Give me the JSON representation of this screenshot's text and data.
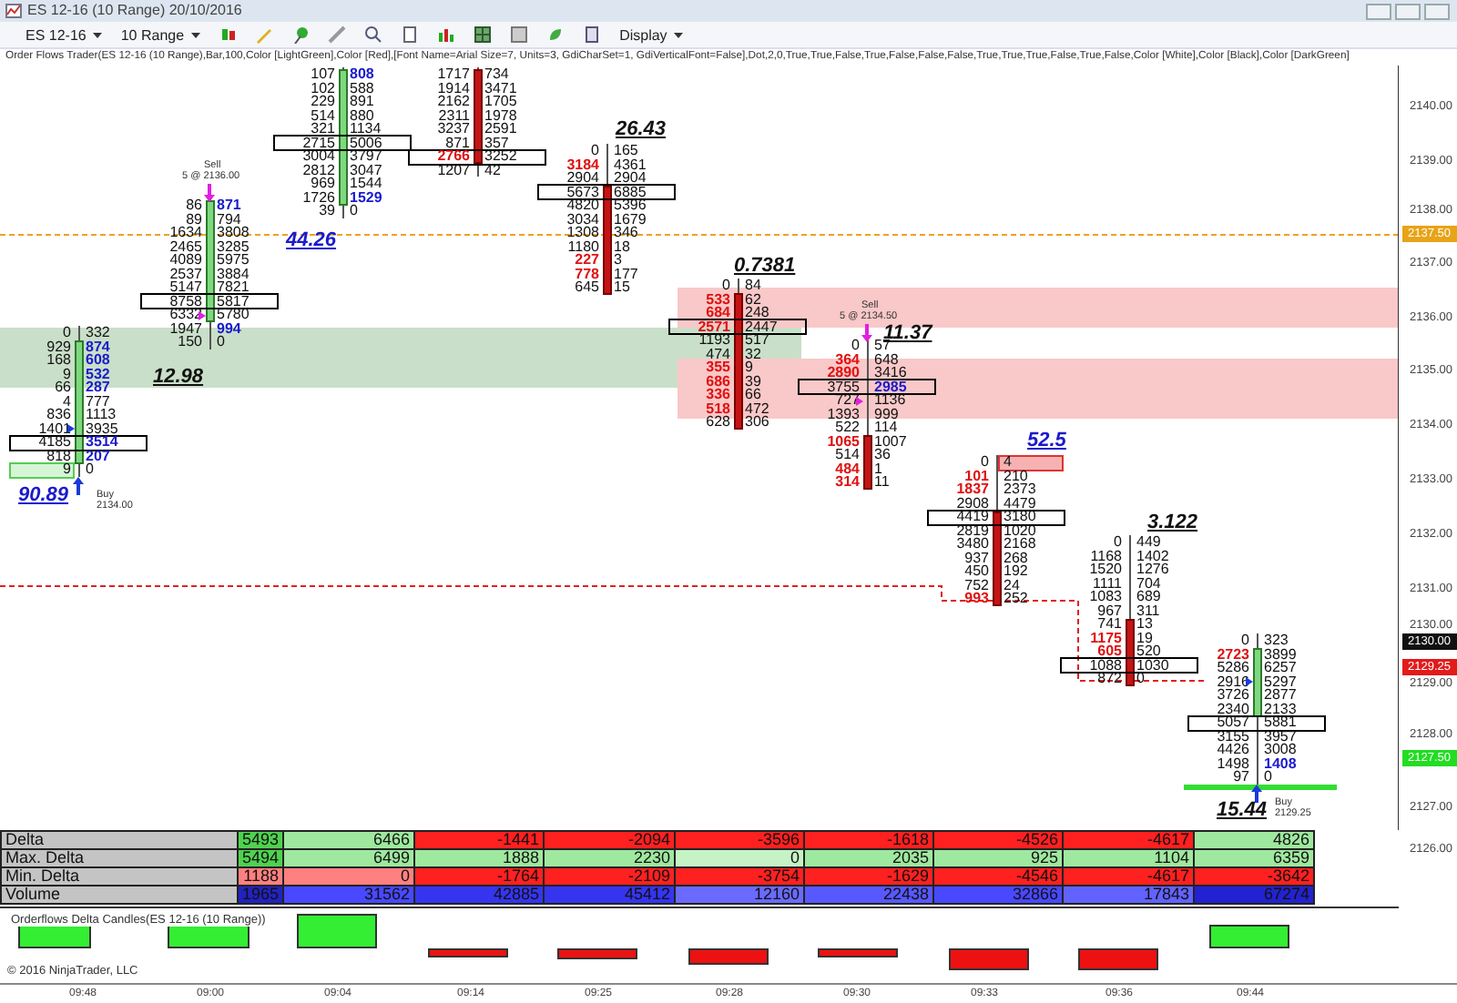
{
  "window": {
    "title": "ES 12-16 (10 Range)  20/10/2016"
  },
  "toolbar": {
    "instrument": "ES 12-16",
    "interval": "10 Range",
    "display": "Display"
  },
  "indicator_label": "Order Flows Trader(ES 12-16 (10 Range),Bar,100,Color [LightGreen],Color [Red],[Font Name=Arial Size=7, Units=3, GdiCharSet=1, GdiVerticalFont=False],Dot,2,0,True,True,False,True,False,False,False,True,True,True,False,True,False,Color [White],Color [Black],Color [DarkGreen]",
  "zones": [
    {
      "kind": "demand"
    },
    {
      "kind": "supply"
    },
    {
      "kind": "supply"
    }
  ],
  "bars": [
    {
      "kind": "up",
      "signal": {
        "kind": "buy",
        "label": "Buy",
        "detail": "2134.00"
      },
      "rows": [
        {
          "bid": {
            "text": "0",
            "kind": "plain"
          },
          "ask": {
            "text": "332",
            "kind": "plain"
          },
          "poc": false
        },
        {
          "bid": {
            "text": "929",
            "kind": "plain"
          },
          "ask": {
            "text": "874",
            "kind": "buy"
          },
          "poc": false
        },
        {
          "bid": {
            "text": "168",
            "kind": "plain"
          },
          "ask": {
            "text": "608",
            "kind": "buy"
          },
          "poc": false
        },
        {
          "bid": {
            "text": "9",
            "kind": "plain"
          },
          "ask": {
            "text": "532",
            "kind": "buy"
          },
          "poc": false
        },
        {
          "bid": {
            "text": "66",
            "kind": "plain"
          },
          "ask": {
            "text": "287",
            "kind": "buy"
          },
          "poc": false
        },
        {
          "bid": {
            "text": "4",
            "kind": "plain"
          },
          "ask": {
            "text": "777",
            "kind": "plain"
          },
          "poc": false
        },
        {
          "bid": {
            "text": "836",
            "kind": "plain"
          },
          "ask": {
            "text": "1113",
            "kind": "plain"
          },
          "poc": false
        },
        {
          "bid": {
            "text": "1401",
            "kind": "plain"
          },
          "ask": {
            "text": "3935",
            "kind": "plain"
          },
          "poc": false
        },
        {
          "bid": {
            "text": "4185",
            "kind": "plain"
          },
          "ask": {
            "text": "3514",
            "kind": "buy"
          },
          "poc": true
        },
        {
          "bid": {
            "text": "818",
            "kind": "plain"
          },
          "ask": {
            "text": "207",
            "kind": "buy"
          },
          "poc": false
        },
        {
          "bid": {
            "text": "9",
            "kind": "green-box"
          },
          "ask": {
            "text": "0",
            "kind": "plain"
          },
          "poc": false
        }
      ]
    },
    {
      "kind": "up",
      "signal": {
        "kind": "sell",
        "label": "Sell",
        "detail": "5 @ 2136.00"
      },
      "rows": [
        {
          "bid": {
            "text": "86",
            "kind": "plain"
          },
          "ask": {
            "text": "871",
            "kind": "buy"
          },
          "poc": false
        },
        {
          "bid": {
            "text": "89",
            "kind": "plain"
          },
          "ask": {
            "text": "794",
            "kind": "plain"
          },
          "poc": false
        },
        {
          "bid": {
            "text": "1634",
            "kind": "plain"
          },
          "ask": {
            "text": "3808",
            "kind": "plain"
          },
          "poc": false
        },
        {
          "bid": {
            "text": "2465",
            "kind": "plain"
          },
          "ask": {
            "text": "3285",
            "kind": "plain"
          },
          "poc": false
        },
        {
          "bid": {
            "text": "4089",
            "kind": "plain"
          },
          "ask": {
            "text": "5975",
            "kind": "plain"
          },
          "poc": false
        },
        {
          "bid": {
            "text": "2537",
            "kind": "plain"
          },
          "ask": {
            "text": "3884",
            "kind": "plain"
          },
          "poc": false
        },
        {
          "bid": {
            "text": "5147",
            "kind": "plain"
          },
          "ask": {
            "text": "7821",
            "kind": "plain"
          },
          "poc": false
        },
        {
          "bid": {
            "text": "8758",
            "kind": "plain"
          },
          "ask": {
            "text": "5817",
            "kind": "plain"
          },
          "poc": true
        },
        {
          "bid": {
            "text": "6332",
            "kind": "plain"
          },
          "ask": {
            "text": "5780",
            "kind": "plain"
          },
          "poc": false
        },
        {
          "bid": {
            "text": "1947",
            "kind": "plain"
          },
          "ask": {
            "text": "994",
            "kind": "buy"
          },
          "poc": false
        },
        {
          "bid": {
            "text": "150",
            "kind": "plain"
          },
          "ask": {
            "text": "0",
            "kind": "plain"
          },
          "poc": false
        }
      ]
    },
    {
      "kind": "up",
      "rows": [
        {
          "bid": {
            "text": "107",
            "kind": "plain"
          },
          "ask": {
            "text": "808",
            "kind": "buy"
          },
          "poc": false
        },
        {
          "bid": {
            "text": "102",
            "kind": "plain"
          },
          "ask": {
            "text": "588",
            "kind": "plain"
          },
          "poc": false
        },
        {
          "bid": {
            "text": "229",
            "kind": "plain"
          },
          "ask": {
            "text": "891",
            "kind": "plain"
          },
          "poc": false
        },
        {
          "bid": {
            "text": "514",
            "kind": "plain"
          },
          "ask": {
            "text": "880",
            "kind": "plain"
          },
          "poc": false
        },
        {
          "bid": {
            "text": "321",
            "kind": "plain"
          },
          "ask": {
            "text": "1134",
            "kind": "plain"
          },
          "poc": false
        },
        {
          "bid": {
            "text": "2715",
            "kind": "plain"
          },
          "ask": {
            "text": "5006",
            "kind": "plain"
          },
          "poc": true
        },
        {
          "bid": {
            "text": "3004",
            "kind": "plain"
          },
          "ask": {
            "text": "3797",
            "kind": "plain"
          },
          "poc": false
        },
        {
          "bid": {
            "text": "2812",
            "kind": "plain"
          },
          "ask": {
            "text": "3047",
            "kind": "plain"
          },
          "poc": false
        },
        {
          "bid": {
            "text": "969",
            "kind": "plain"
          },
          "ask": {
            "text": "1544",
            "kind": "plain"
          },
          "poc": false
        },
        {
          "bid": {
            "text": "1726",
            "kind": "plain"
          },
          "ask": {
            "text": "1529",
            "kind": "buy"
          },
          "poc": false
        },
        {
          "bid": {
            "text": "39",
            "kind": "plain"
          },
          "ask": {
            "text": "0",
            "kind": "plain"
          },
          "poc": false
        }
      ]
    },
    {
      "kind": "down",
      "rows": [
        {
          "bid": {
            "text": "1717",
            "kind": "plain"
          },
          "ask": {
            "text": "734",
            "kind": "plain"
          },
          "poc": false
        },
        {
          "bid": {
            "text": "1914",
            "kind": "plain"
          },
          "ask": {
            "text": "3471",
            "kind": "plain"
          },
          "poc": false
        },
        {
          "bid": {
            "text": "2162",
            "kind": "plain"
          },
          "ask": {
            "text": "1705",
            "kind": "plain"
          },
          "poc": false
        },
        {
          "bid": {
            "text": "2311",
            "kind": "plain"
          },
          "ask": {
            "text": "1978",
            "kind": "plain"
          },
          "poc": false
        },
        {
          "bid": {
            "text": "3237",
            "kind": "plain"
          },
          "ask": {
            "text": "2591",
            "kind": "plain"
          },
          "poc": false
        },
        {
          "bid": {
            "text": "871",
            "kind": "plain"
          },
          "ask": {
            "text": "357",
            "kind": "plain"
          },
          "poc": false
        },
        {
          "bid": {
            "text": "2766",
            "kind": "sell"
          },
          "ask": {
            "text": "3252",
            "kind": "plain"
          },
          "poc": true
        },
        {
          "bid": {
            "text": "1207",
            "kind": "plain"
          },
          "ask": {
            "text": "42",
            "kind": "plain"
          },
          "poc": false
        }
      ]
    },
    {
      "kind": "down",
      "rows": [
        {
          "bid": {
            "text": "0",
            "kind": "plain"
          },
          "ask": {
            "text": "165",
            "kind": "plain"
          },
          "poc": false
        },
        {
          "bid": {
            "text": "3184",
            "kind": "sell"
          },
          "ask": {
            "text": "4361",
            "kind": "plain"
          },
          "poc": false
        },
        {
          "bid": {
            "text": "2904",
            "kind": "plain"
          },
          "ask": {
            "text": "2904",
            "kind": "plain"
          },
          "poc": false
        },
        {
          "bid": {
            "text": "5673",
            "kind": "plain"
          },
          "ask": {
            "text": "6885",
            "kind": "plain"
          },
          "poc": true
        },
        {
          "bid": {
            "text": "4820",
            "kind": "plain"
          },
          "ask": {
            "text": "5396",
            "kind": "plain"
          },
          "poc": false
        },
        {
          "bid": {
            "text": "3034",
            "kind": "plain"
          },
          "ask": {
            "text": "1679",
            "kind": "plain"
          },
          "poc": false
        },
        {
          "bid": {
            "text": "1308",
            "kind": "plain"
          },
          "ask": {
            "text": "346",
            "kind": "plain"
          },
          "poc": false
        },
        {
          "bid": {
            "text": "1180",
            "kind": "plain"
          },
          "ask": {
            "text": "18",
            "kind": "plain"
          },
          "poc": false
        },
        {
          "bid": {
            "text": "227",
            "kind": "sell"
          },
          "ask": {
            "text": "3",
            "kind": "plain"
          },
          "poc": false
        },
        {
          "bid": {
            "text": "778",
            "kind": "sell"
          },
          "ask": {
            "text": "177",
            "kind": "plain"
          },
          "poc": false
        },
        {
          "bid": {
            "text": "645",
            "kind": "plain"
          },
          "ask": {
            "text": "15",
            "kind": "plain"
          },
          "poc": false
        }
      ]
    },
    {
      "kind": "down",
      "rows": [
        {
          "bid": {
            "text": "0",
            "kind": "plain"
          },
          "ask": {
            "text": "84",
            "kind": "plain"
          },
          "poc": false
        },
        {
          "bid": {
            "text": "533",
            "kind": "sell"
          },
          "ask": {
            "text": "62",
            "kind": "plain"
          },
          "poc": false
        },
        {
          "bid": {
            "text": "684",
            "kind": "sell"
          },
          "ask": {
            "text": "248",
            "kind": "plain"
          },
          "poc": false
        },
        {
          "bid": {
            "text": "2571",
            "kind": "sell"
          },
          "ask": {
            "text": "2447",
            "kind": "plain"
          },
          "poc": true
        },
        {
          "bid": {
            "text": "1193",
            "kind": "plain"
          },
          "ask": {
            "text": "517",
            "kind": "plain"
          },
          "poc": false
        },
        {
          "bid": {
            "text": "474",
            "kind": "plain"
          },
          "ask": {
            "text": "32",
            "kind": "plain"
          },
          "poc": false
        },
        {
          "bid": {
            "text": "355",
            "kind": "sell"
          },
          "ask": {
            "text": "9",
            "kind": "plain"
          },
          "poc": false
        },
        {
          "bid": {
            "text": "686",
            "kind": "sell"
          },
          "ask": {
            "text": "39",
            "kind": "plain"
          },
          "poc": false
        },
        {
          "bid": {
            "text": "336",
            "kind": "sell"
          },
          "ask": {
            "text": "66",
            "kind": "plain"
          },
          "poc": false
        },
        {
          "bid": {
            "text": "518",
            "kind": "sell"
          },
          "ask": {
            "text": "472",
            "kind": "plain"
          },
          "poc": false
        },
        {
          "bid": {
            "text": "628",
            "kind": "plain"
          },
          "ask": {
            "text": "306",
            "kind": "plain"
          },
          "poc": false
        }
      ]
    },
    {
      "kind": "down",
      "signal": {
        "kind": "sell",
        "label": "Sell",
        "detail": "5 @ 2134.50"
      },
      "rows": [
        {
          "bid": {
            "text": "0",
            "kind": "plain"
          },
          "ask": {
            "text": "57",
            "kind": "plain"
          },
          "poc": false
        },
        {
          "bid": {
            "text": "364",
            "kind": "sell"
          },
          "ask": {
            "text": "648",
            "kind": "plain"
          },
          "poc": false
        },
        {
          "bid": {
            "text": "2890",
            "kind": "sell"
          },
          "ask": {
            "text": "3416",
            "kind": "plain"
          },
          "poc": false
        },
        {
          "bid": {
            "text": "3755",
            "kind": "plain"
          },
          "ask": {
            "text": "2985",
            "kind": "buy"
          },
          "poc": true
        },
        {
          "bid": {
            "text": "727",
            "kind": "plain"
          },
          "ask": {
            "text": "1136",
            "kind": "plain"
          },
          "poc": false
        },
        {
          "bid": {
            "text": "1393",
            "kind": "plain"
          },
          "ask": {
            "text": "999",
            "kind": "plain"
          },
          "poc": false
        },
        {
          "bid": {
            "text": "522",
            "kind": "plain"
          },
          "ask": {
            "text": "114",
            "kind": "plain"
          },
          "poc": false
        },
        {
          "bid": {
            "text": "1065",
            "kind": "sell"
          },
          "ask": {
            "text": "1007",
            "kind": "plain"
          },
          "poc": false
        },
        {
          "bid": {
            "text": "514",
            "kind": "plain"
          },
          "ask": {
            "text": "36",
            "kind": "plain"
          },
          "poc": false
        },
        {
          "bid": {
            "text": "484",
            "kind": "sell"
          },
          "ask": {
            "text": "1",
            "kind": "plain"
          },
          "poc": false
        },
        {
          "bid": {
            "text": "314",
            "kind": "sell"
          },
          "ask": {
            "text": "11",
            "kind": "plain"
          },
          "poc": false
        }
      ]
    },
    {
      "kind": "down",
      "rows": [
        {
          "bid": {
            "text": "0",
            "kind": "plain"
          },
          "ask": {
            "text": "4",
            "kind": "pink-box"
          },
          "poc": false
        },
        {
          "bid": {
            "text": "101",
            "kind": "sell"
          },
          "ask": {
            "text": "210",
            "kind": "plain"
          },
          "poc": false
        },
        {
          "bid": {
            "text": "1837",
            "kind": "sell"
          },
          "ask": {
            "text": "2373",
            "kind": "plain"
          },
          "poc": false
        },
        {
          "bid": {
            "text": "2908",
            "kind": "plain"
          },
          "ask": {
            "text": "4479",
            "kind": "plain"
          },
          "poc": false
        },
        {
          "bid": {
            "text": "4419",
            "kind": "plain"
          },
          "ask": {
            "text": "3180",
            "kind": "plain"
          },
          "poc": true
        },
        {
          "bid": {
            "text": "2819",
            "kind": "plain"
          },
          "ask": {
            "text": "1020",
            "kind": "plain"
          },
          "poc": false
        },
        {
          "bid": {
            "text": "3480",
            "kind": "plain"
          },
          "ask": {
            "text": "2168",
            "kind": "plain"
          },
          "poc": false
        },
        {
          "bid": {
            "text": "937",
            "kind": "plain"
          },
          "ask": {
            "text": "268",
            "kind": "plain"
          },
          "poc": false
        },
        {
          "bid": {
            "text": "450",
            "kind": "plain"
          },
          "ask": {
            "text": "192",
            "kind": "plain"
          },
          "poc": false
        },
        {
          "bid": {
            "text": "752",
            "kind": "plain"
          },
          "ask": {
            "text": "24",
            "kind": "plain"
          },
          "poc": false
        },
        {
          "bid": {
            "text": "993",
            "kind": "sell"
          },
          "ask": {
            "text": "252",
            "kind": "plain"
          },
          "poc": false
        }
      ]
    },
    {
      "kind": "down",
      "rows": [
        {
          "bid": {
            "text": "0",
            "kind": "plain"
          },
          "ask": {
            "text": "449",
            "kind": "plain"
          },
          "poc": false
        },
        {
          "bid": {
            "text": "1168",
            "kind": "plain"
          },
          "ask": {
            "text": "1402",
            "kind": "plain"
          },
          "poc": false
        },
        {
          "bid": {
            "text": "1520",
            "kind": "plain"
          },
          "ask": {
            "text": "1276",
            "kind": "plain"
          },
          "poc": false
        },
        {
          "bid": {
            "text": "1111",
            "kind": "plain"
          },
          "ask": {
            "text": "704",
            "kind": "plain"
          },
          "poc": false
        },
        {
          "bid": {
            "text": "1083",
            "kind": "plain"
          },
          "ask": {
            "text": "689",
            "kind": "plain"
          },
          "poc": false
        },
        {
          "bid": {
            "text": "967",
            "kind": "plain"
          },
          "ask": {
            "text": "311",
            "kind": "plain"
          },
          "poc": false
        },
        {
          "bid": {
            "text": "741",
            "kind": "plain"
          },
          "ask": {
            "text": "13",
            "kind": "plain"
          },
          "poc": false
        },
        {
          "bid": {
            "text": "1175",
            "kind": "sell"
          },
          "ask": {
            "text": "19",
            "kind": "plain"
          },
          "poc": false
        },
        {
          "bid": {
            "text": "605",
            "kind": "sell"
          },
          "ask": {
            "text": "520",
            "kind": "plain"
          },
          "poc": false
        },
        {
          "bid": {
            "text": "1088",
            "kind": "plain"
          },
          "ask": {
            "text": "1030",
            "kind": "plain"
          },
          "poc": true
        },
        {
          "bid": {
            "text": "872",
            "kind": "plain"
          },
          "ask": {
            "text": "0",
            "kind": "plain"
          },
          "poc": false
        }
      ]
    },
    {
      "kind": "up",
      "signal": {
        "kind": "buy",
        "label": "Buy",
        "detail": "2129.25"
      },
      "rows": [
        {
          "bid": {
            "text": "0",
            "kind": "plain"
          },
          "ask": {
            "text": "323",
            "kind": "plain"
          },
          "poc": false
        },
        {
          "bid": {
            "text": "2723",
            "kind": "sell"
          },
          "ask": {
            "text": "3899",
            "kind": "plain"
          },
          "poc": false
        },
        {
          "bid": {
            "text": "5286",
            "kind": "plain"
          },
          "ask": {
            "text": "6257",
            "kind": "plain"
          },
          "poc": false
        },
        {
          "bid": {
            "text": "2916",
            "kind": "plain"
          },
          "ask": {
            "text": "5297",
            "kind": "plain"
          },
          "poc": false
        },
        {
          "bid": {
            "text": "3726",
            "kind": "plain"
          },
          "ask": {
            "text": "2877",
            "kind": "plain"
          },
          "poc": false
        },
        {
          "bid": {
            "text": "2340",
            "kind": "plain"
          },
          "ask": {
            "text": "2133",
            "kind": "plain"
          },
          "poc": false
        },
        {
          "bid": {
            "text": "5057",
            "kind": "plain"
          },
          "ask": {
            "text": "5881",
            "kind": "plain"
          },
          "poc": true
        },
        {
          "bid": {
            "text": "3155",
            "kind": "plain"
          },
          "ask": {
            "text": "3957",
            "kind": "plain"
          },
          "poc": false
        },
        {
          "bid": {
            "text": "4426",
            "kind": "plain"
          },
          "ask": {
            "text": "3008",
            "kind": "plain"
          },
          "poc": false
        },
        {
          "bid": {
            "text": "1498",
            "kind": "plain"
          },
          "ask": {
            "text": "1408",
            "kind": "buy"
          },
          "poc": false
        },
        {
          "bid": {
            "text": "97",
            "kind": "green-line"
          },
          "ask": {
            "text": "0",
            "kind": "plain"
          },
          "poc": false
        }
      ]
    }
  ],
  "ratio_labels": [
    {
      "text": "90.89",
      "color": "#1a1acc"
    },
    {
      "text": "12.98",
      "color": "#111111"
    },
    {
      "text": "44.26",
      "color": "#1a1acc"
    },
    {
      "text": "26.43",
      "color": "#111111"
    },
    {
      "text": "0.7381",
      "color": "#111111"
    },
    {
      "text": "11.37",
      "color": "#111111"
    },
    {
      "text": "52.5",
      "color": "#1a1acc"
    },
    {
      "text": "3.122",
      "color": "#111111"
    },
    {
      "text": "15.44",
      "color": "#111111"
    }
  ],
  "price_axis": [
    "2140.00",
    "2139.00",
    "2138.00",
    "2137.00",
    "2136.00",
    "2135.00",
    "2134.00",
    "2133.00",
    "2132.00",
    "2131.00",
    "2130.00",
    "2129.00",
    "2128.00",
    "2127.00",
    "2126.00"
  ],
  "price_markers": [
    {
      "text": "2137.50",
      "color": "#e8a317"
    },
    {
      "text": "2130.00",
      "color": "#111111"
    },
    {
      "text": "2129.25",
      "color": "#e21b1b"
    },
    {
      "text": "2127.50",
      "color": "#22dd22"
    }
  ],
  "stats_table": {
    "rows": [
      {
        "label": "Delta",
        "cells": [
          {
            "text": "5493",
            "color": "#4fd24f"
          },
          {
            "text": "6466",
            "color": "#9fe89f"
          },
          {
            "text": "-1441",
            "color": "#ff2020"
          },
          {
            "text": "-2094",
            "color": "#ff2020"
          },
          {
            "text": "-3596",
            "color": "#ff2020"
          },
          {
            "text": "-1618",
            "color": "#ff2020"
          },
          {
            "text": "-4526",
            "color": "#ff2020"
          },
          {
            "text": "-4617",
            "color": "#ff2020"
          },
          {
            "text": "4826",
            "color": "#9fe89f"
          }
        ]
      },
      {
        "label": "Max. Delta",
        "cells": [
          {
            "text": "5494",
            "color": "#4fd24f"
          },
          {
            "text": "6499",
            "color": "#9fe89f"
          },
          {
            "text": "1888",
            "color": "#9fe89f"
          },
          {
            "text": "2230",
            "color": "#9fe89f"
          },
          {
            "text": "0",
            "color": "#c6f3c6"
          },
          {
            "text": "2035",
            "color": "#9fe89f"
          },
          {
            "text": "925",
            "color": "#9fe89f"
          },
          {
            "text": "1104",
            "color": "#9fe89f"
          },
          {
            "text": "6359",
            "color": "#9fe89f"
          }
        ]
      },
      {
        "label": "Min. Delta",
        "cells": [
          {
            "text": "1188",
            "color": "#ff8080"
          },
          {
            "text": "0",
            "color": "#ff8080"
          },
          {
            "text": "-1764",
            "color": "#ff2020"
          },
          {
            "text": "-2109",
            "color": "#ff2020"
          },
          {
            "text": "-3754",
            "color": "#ff2020"
          },
          {
            "text": "-1629",
            "color": "#ff2020"
          },
          {
            "text": "-4546",
            "color": "#ff2020"
          },
          {
            "text": "-4617",
            "color": "#ff2020"
          },
          {
            "text": "-3642",
            "color": "#ff2020"
          }
        ]
      },
      {
        "label": "Volume",
        "cells": [
          {
            "text": "1965",
            "color": "#2222c0"
          },
          {
            "text": "31562",
            "color": "#4848ff"
          },
          {
            "text": "42885",
            "color": "#3535f0"
          },
          {
            "text": "45412",
            "color": "#3535f0"
          },
          {
            "text": "12160",
            "color": "#6a6aff"
          },
          {
            "text": "22438",
            "color": "#5858ff"
          },
          {
            "text": "32866",
            "color": "#4848ff"
          },
          {
            "text": "17843",
            "color": "#6262ff"
          },
          {
            "text": "67274",
            "color": "#2222d0"
          }
        ]
      }
    ]
  },
  "delta_panel": {
    "title": "Orderflows Delta Candles(ES 12-16 (10 Range))",
    "copyright": "© 2016 NinjaTrader, LLC",
    "candles": [
      {
        "kind": "up"
      },
      {
        "kind": "up"
      },
      {
        "kind": "up"
      },
      {
        "kind": "down"
      },
      {
        "kind": "down"
      },
      {
        "kind": "down"
      },
      {
        "kind": "down"
      },
      {
        "kind": "down"
      },
      {
        "kind": "down"
      },
      {
        "kind": "up"
      }
    ]
  },
  "time_axis": [
    "09:48",
    "09:00",
    "09:04",
    "09:14",
    "09:25",
    "09:28",
    "09:30",
    "09:33",
    "09:36",
    "09:44"
  ]
}
